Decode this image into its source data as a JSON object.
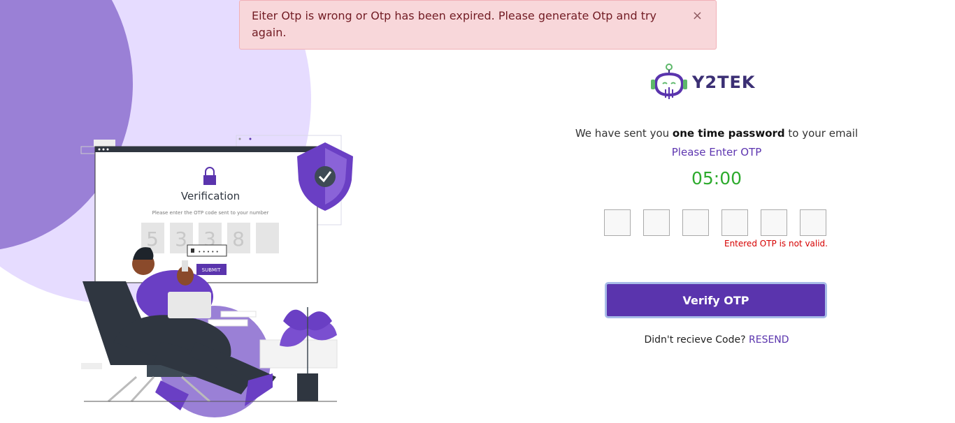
{
  "alert": {
    "message": "Eiter Otp is wrong or Otp has been expired. Please generate Otp and try again.",
    "close_label": "×"
  },
  "logo": {
    "text": "Y2TEK"
  },
  "otp": {
    "sent_prefix": "We have sent you ",
    "sent_bold": "one time password",
    "sent_suffix": " to your email",
    "please_enter": "Please Enter OTP",
    "timer": "05:00",
    "boxes": [
      "",
      "",
      "",
      "",
      "",
      ""
    ],
    "error": "Entered OTP is not valid.",
    "verify_label": "Verify OTP",
    "resend_prefix": "Didn't recieve Code?",
    "resend_label": "RESEND"
  },
  "illustration": {
    "title": "Verification",
    "subtitle": "Please enter the OTP code sent to your number",
    "digits": [
      "5",
      "3",
      "3",
      "8",
      ""
    ],
    "password_mask": "• • • • •",
    "submit_label": "SUBMIT"
  },
  "colors": {
    "primary": "#5a34ad",
    "success": "#2eab2e",
    "error": "#d60000",
    "alert_bg": "#f8d7da",
    "alert_text": "#721c24",
    "blob_light": "#e6dcff",
    "blob_dark": "#9a80d6"
  },
  "icons": {
    "close": "close-icon",
    "logo": "robot-headset-icon",
    "lock": "padlock-icon",
    "shield": "shield-check-icon"
  }
}
